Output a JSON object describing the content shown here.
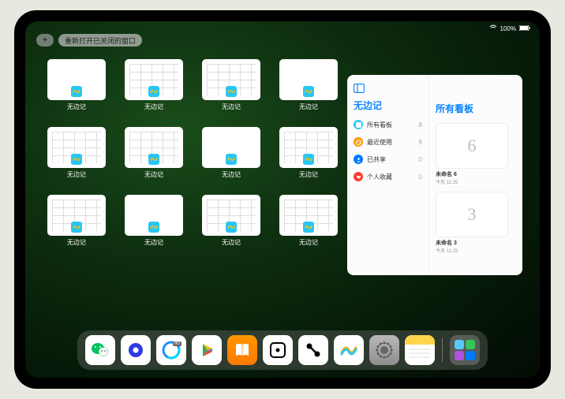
{
  "status": {
    "signal_icon": "wifi",
    "battery": "100%"
  },
  "top": {
    "plus_label": "+",
    "reopen_label": "重新打开已关闭的窗口"
  },
  "app_name": "无边记",
  "windows": [
    {
      "label": "无边记",
      "variant": "blank"
    },
    {
      "label": "无边记",
      "variant": "grid"
    },
    {
      "label": "无边记",
      "variant": "grid"
    },
    {
      "label": "无边记",
      "variant": "blank"
    },
    {
      "label": "无边记",
      "variant": "grid"
    },
    {
      "label": "无边记",
      "variant": "grid"
    },
    {
      "label": "无边记",
      "variant": "blank"
    },
    {
      "label": "无边记",
      "variant": "grid"
    },
    {
      "label": "无边记",
      "variant": "grid"
    },
    {
      "label": "无边记",
      "variant": "blank"
    },
    {
      "label": "无边记",
      "variant": "grid"
    },
    {
      "label": "无边记",
      "variant": "grid"
    }
  ],
  "side_panel": {
    "left_title": "无边记",
    "items": [
      {
        "icon_color": "#29c5f6",
        "label": "所有看板",
        "count": 8
      },
      {
        "icon_color": "#ff9500",
        "label": "最近使用",
        "count": 8
      },
      {
        "icon_color": "#007aff",
        "label": "已共享",
        "count": 0
      },
      {
        "icon_color": "#ff3b30",
        "label": "个人收藏",
        "count": 0
      }
    ],
    "right_title": "所有看板",
    "boards": [
      {
        "glyph": "6",
        "name": "未命名 6",
        "sub": "今天 11:25"
      },
      {
        "glyph": "3",
        "name": "未命名 3",
        "sub": "今天 11:25"
      }
    ]
  },
  "dock": {
    "items": [
      {
        "name": "wechat",
        "bg": "#fff"
      },
      {
        "name": "quark",
        "bg": "#fff"
      },
      {
        "name": "qq-browser",
        "bg": "#fff",
        "badge": "HD"
      },
      {
        "name": "play",
        "bg": "#fff"
      },
      {
        "name": "books",
        "bg": "linear-gradient(#ff9500,#ff7a00)"
      },
      {
        "name": "dice",
        "bg": "#fff"
      },
      {
        "name": "connect",
        "bg": "#fff"
      },
      {
        "name": "freeform",
        "bg": "#fff"
      },
      {
        "name": "settings",
        "bg": "linear-gradient(#b8b8b8,#8e8e8e)"
      },
      {
        "name": "notes",
        "bg": "#fff"
      },
      {
        "name": "app-library",
        "bg": "rgba(255,255,255,0.2)"
      }
    ]
  }
}
